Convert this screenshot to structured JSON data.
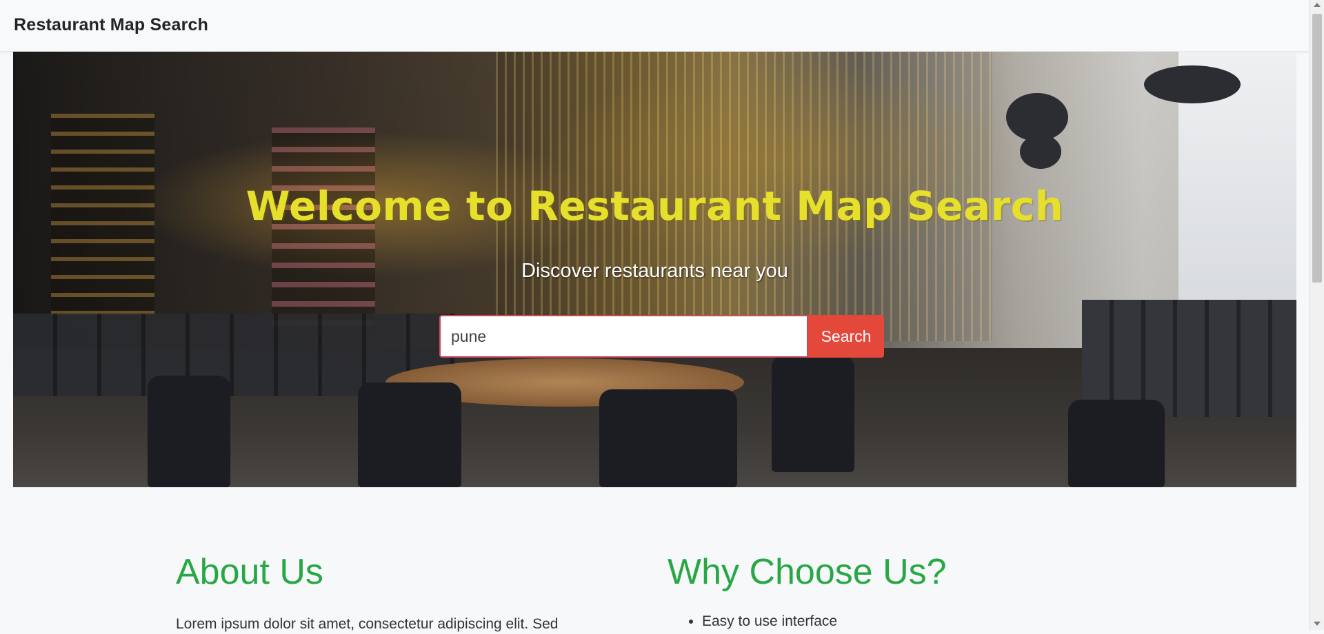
{
  "navbar": {
    "brand": "Restaurant Map Search"
  },
  "hero": {
    "title": "Welcome to Restaurant Map Search",
    "subtitle": "Discover restaurants near you",
    "search": {
      "value": "pune",
      "button_label": "Search"
    }
  },
  "about": {
    "heading": "About Us",
    "text": "Lorem ipsum dolor sit amet, consectetur adipiscing elit. Sed"
  },
  "why": {
    "heading": "Why Choose Us?",
    "items": [
      "Easy to use interface"
    ]
  },
  "colors": {
    "accent_green": "#28a745",
    "title_yellow": "#e6e02c",
    "search_button": "#e4483b"
  }
}
